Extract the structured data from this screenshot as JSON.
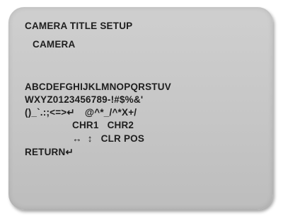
{
  "menu": {
    "title": "CAMERA TITLE SETUP",
    "camera_title_value": "CAMERA"
  },
  "char_table": {
    "row1": "ABCDEFGHIJKLMNOPQRSTUV",
    "row2": "WXYZ0123456789-!#$%&'",
    "row3_left": "()_`.:;<=>↵",
    "row3_right": "@^*_/^*X+/",
    "chr1": "CHR1",
    "chr2": "CHR2",
    "cursor_arrows_lr": "↔",
    "cursor_arrows_ud": "↕",
    "clr_pos": "CLR POS",
    "return": "RETURN↵"
  }
}
